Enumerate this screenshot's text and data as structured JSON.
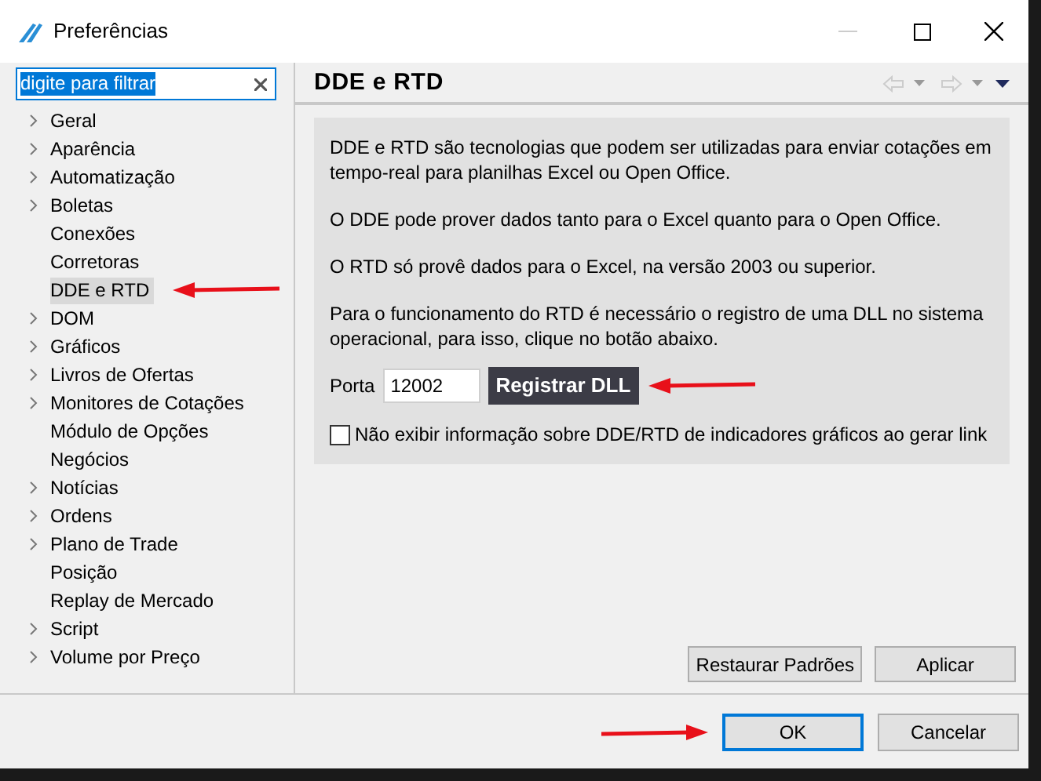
{
  "window": {
    "title": "Preferências"
  },
  "filter": {
    "value": "digite para filtrar"
  },
  "tree": [
    {
      "label": "Geral",
      "expandable": true,
      "selected": false
    },
    {
      "label": "Aparência",
      "expandable": true,
      "selected": false
    },
    {
      "label": "Automatização",
      "expandable": true,
      "selected": false
    },
    {
      "label": "Boletas",
      "expandable": true,
      "selected": false
    },
    {
      "label": "Conexões",
      "expandable": false,
      "selected": false
    },
    {
      "label": "Corretoras",
      "expandable": false,
      "selected": false
    },
    {
      "label": "DDE e RTD",
      "expandable": false,
      "selected": true
    },
    {
      "label": "DOM",
      "expandable": true,
      "selected": false
    },
    {
      "label": "Gráficos",
      "expandable": true,
      "selected": false
    },
    {
      "label": "Livros de Ofertas",
      "expandable": true,
      "selected": false
    },
    {
      "label": "Monitores de Cotações",
      "expandable": true,
      "selected": false
    },
    {
      "label": "Módulo de Opções",
      "expandable": false,
      "selected": false
    },
    {
      "label": "Negócios",
      "expandable": false,
      "selected": false
    },
    {
      "label": "Notícias",
      "expandable": true,
      "selected": false
    },
    {
      "label": "Ordens",
      "expandable": true,
      "selected": false
    },
    {
      "label": "Plano de Trade",
      "expandable": true,
      "selected": false
    },
    {
      "label": "Posição",
      "expandable": false,
      "selected": false
    },
    {
      "label": "Replay de Mercado",
      "expandable": false,
      "selected": false
    },
    {
      "label": "Script",
      "expandable": true,
      "selected": false
    },
    {
      "label": "Volume por Preço",
      "expandable": true,
      "selected": false
    }
  ],
  "page": {
    "title": "DDE e RTD",
    "paragraphs": [
      "DDE e RTD são tecnologias que podem ser utilizadas para enviar cotações em tempo-real para planilhas Excel ou Open Office.",
      "O DDE pode prover dados tanto para o Excel quanto para o Open Office.",
      "O RTD só provê dados para o Excel, na versão 2003 ou superior.",
      "Para o funcionamento do RTD é necessário o registro de uma DLL no sistema operacional, para isso, clique no botão abaixo."
    ],
    "port_label": "Porta",
    "port_value": "12002",
    "register_button": "Registrar DLL",
    "checkbox": {
      "label": "Não exibir informação sobre DDE/RTD de indicadores gráficos ao gerar link",
      "checked": false
    },
    "buttons": [
      "Restaurar Padrões",
      "Aplicar"
    ]
  },
  "dialog_buttons": [
    {
      "label": "OK",
      "selected": true
    },
    {
      "label": "Cancelar",
      "selected": false
    }
  ]
}
